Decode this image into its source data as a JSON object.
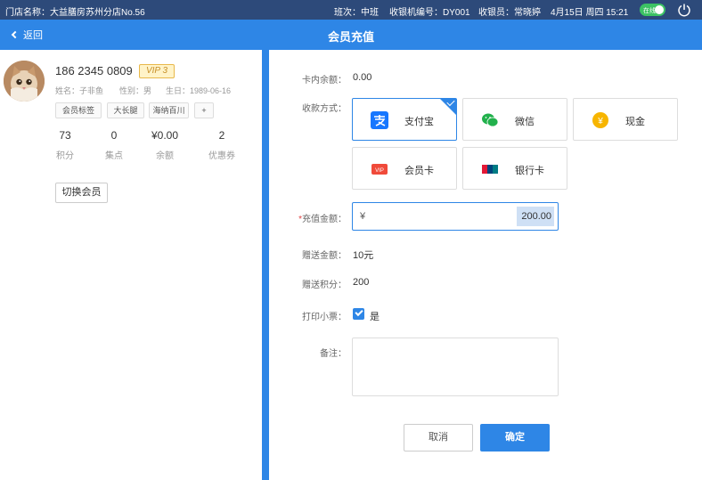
{
  "statusbar": {
    "store": "门店名称：大益膳房苏州分店No.56",
    "shift": "班次：中班",
    "register": "收银机编号：DY001",
    "cashier": "收银员：常晓婷",
    "datetime": "4月15日 周四 15:21",
    "online_label": "在线",
    "online_color": "#3cc264"
  },
  "header": {
    "back_label": "返回",
    "title": "会员充值",
    "color": "#2e86e6"
  },
  "member": {
    "phone": "186 2345 0809",
    "vip": "VIP 3",
    "name": "姓名：子非鱼",
    "gender": "性别：男",
    "birthday": "生日：1989-06-16",
    "tags": [
      "会员标签",
      "大长腿",
      "海纳百川",
      "+"
    ],
    "stats": [
      {
        "value": "73",
        "label": "积分"
      },
      {
        "value": "0",
        "label": "集点"
      },
      {
        "value": "¥0.00",
        "label": "余额"
      },
      {
        "value": "2",
        "label": "优惠券"
      }
    ],
    "switch_label": "切换会员"
  },
  "form": {
    "balance_label": "卡内余额：",
    "balance_value": "0.00",
    "pay_label": "收款方式：",
    "pay_methods": [
      {
        "name": "支付宝",
        "icon": "alipay-icon",
        "selected": true
      },
      {
        "name": "微信",
        "icon": "wechat-icon",
        "selected": false
      },
      {
        "name": "现金",
        "icon": "cash-icon",
        "selected": false
      },
      {
        "name": "会员卡",
        "icon": "vip-card-icon",
        "selected": false
      },
      {
        "name": "银行卡",
        "icon": "bank-card-icon",
        "selected": false
      }
    ],
    "amount_required": "*",
    "amount_label": "充值金额：",
    "amount_currency": "¥",
    "amount_value": "200.00",
    "gift_amount_label": "赠送金额：",
    "gift_amount_value": "10元",
    "gift_points_label": "赠送积分：",
    "gift_points_value": "200",
    "print_label": "打印小票：",
    "print_value": "是",
    "remark_label": "备注：",
    "remark_value": "",
    "cancel_label": "取消",
    "confirm_label": "确定"
  }
}
